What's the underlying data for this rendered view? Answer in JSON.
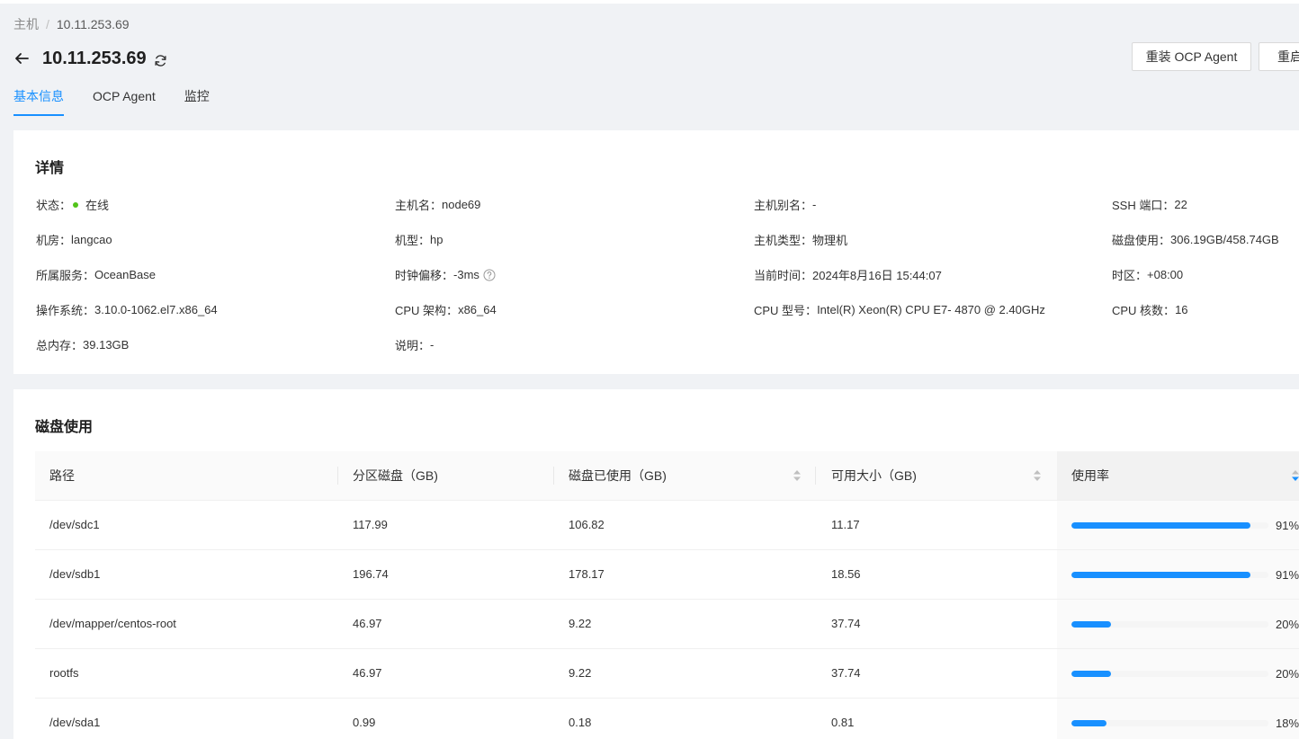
{
  "breadcrumb": {
    "parent": "主机",
    "separator": "/",
    "current": "10.11.253.69"
  },
  "header": {
    "title": "10.11.253.69"
  },
  "actions": {
    "reinstall_label": "重装 OCP Agent",
    "restart_label": "重启"
  },
  "tabs": [
    {
      "label": "基本信息",
      "active": true
    },
    {
      "label": "OCP Agent",
      "active": false
    },
    {
      "label": "监控",
      "active": false
    }
  ],
  "detail": {
    "title": "详情",
    "status": {
      "label": "状态：",
      "value": "在线",
      "color": "#52c41a"
    },
    "hostname": {
      "label": "主机名：",
      "value": "node69"
    },
    "alias": {
      "label": "主机别名：",
      "value": "-"
    },
    "ssh_port": {
      "label": "SSH 端口：",
      "value": "22"
    },
    "idc": {
      "label": "机房：",
      "value": "langcao"
    },
    "model": {
      "label": "机型：",
      "value": "hp"
    },
    "host_type": {
      "label": "主机类型：",
      "value": "物理机"
    },
    "disk_usage": {
      "label": "磁盘使用：",
      "value": "306.19GB/458.74GB"
    },
    "service": {
      "label": "所属服务：",
      "value": "OceanBase"
    },
    "clock_offset": {
      "label": "时钟偏移：",
      "value": "-3ms"
    },
    "current_time": {
      "label": "当前时间：",
      "value": "2024年8月16日 15:44:07"
    },
    "timezone": {
      "label": "时区：",
      "value": "+08:00"
    },
    "os": {
      "label": "操作系统：",
      "value": "3.10.0-1062.el7.x86_64"
    },
    "cpu_arch": {
      "label": "CPU 架构：",
      "value": "x86_64"
    },
    "cpu_model": {
      "label": "CPU 型号：",
      "value": "Intel(R) Xeon(R) CPU E7- 4870 @ 2.40GHz"
    },
    "cpu_cores": {
      "label": "CPU 核数：",
      "value": "16"
    },
    "memory": {
      "label": "总内存：",
      "value": "39.13GB"
    },
    "description": {
      "label": "说明：",
      "value": "-"
    }
  },
  "disk": {
    "title": "磁盘使用",
    "columns": [
      "路径",
      "分区磁盘（GB)",
      "磁盘已使用（GB)",
      "可用大小（GB)",
      "使用率"
    ],
    "rows": [
      {
        "path": "/dev/sdc1",
        "total": "117.99",
        "used": "106.82",
        "available": "11.17",
        "usage": "91%",
        "usage_value": 91
      },
      {
        "path": "/dev/sdb1",
        "total": "196.74",
        "used": "178.17",
        "available": "18.56",
        "usage": "91%",
        "usage_value": 91
      },
      {
        "path": "/dev/mapper/centos-root",
        "total": "46.97",
        "used": "9.22",
        "available": "37.74",
        "usage": "20%",
        "usage_value": 20
      },
      {
        "path": "rootfs",
        "total": "46.97",
        "used": "9.22",
        "available": "37.74",
        "usage": "20%",
        "usage_value": 20
      },
      {
        "path": "/dev/sda1",
        "total": "0.99",
        "used": "0.18",
        "available": "0.81",
        "usage": "18%",
        "usage_value": 18
      }
    ]
  },
  "colors": {
    "accent": "#1890ff",
    "online": "#52c41a"
  },
  "icons": [
    "arrow-left-icon",
    "refresh-icon",
    "help-circle-icon",
    "sort-icon"
  ]
}
